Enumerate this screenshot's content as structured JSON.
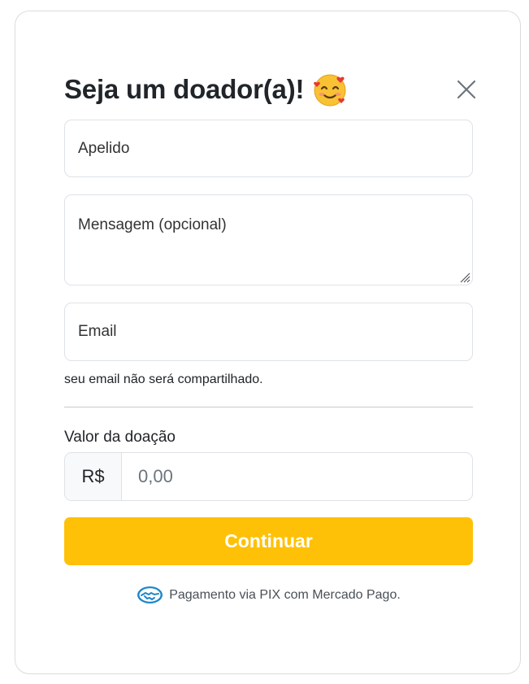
{
  "modal": {
    "title": "Seja um doador(a)!",
    "title_emoji": "smiling-face-with-hearts-icon"
  },
  "form": {
    "nickname_placeholder": "Apelido",
    "message_placeholder": "Mensagem (opcional)",
    "email_placeholder": "Email",
    "email_hint": "seu email não será compartilhado.",
    "amount_label": "Valor da doação",
    "currency_prefix": "R$",
    "amount_placeholder": "0,00",
    "continue_label": "Continuar"
  },
  "footer": {
    "text": "Pagamento via PIX com Mercado Pago.",
    "icon": "mercado-pago-handshake-icon"
  },
  "colors": {
    "accent": "#ffc107",
    "border": "#dee2e6"
  }
}
